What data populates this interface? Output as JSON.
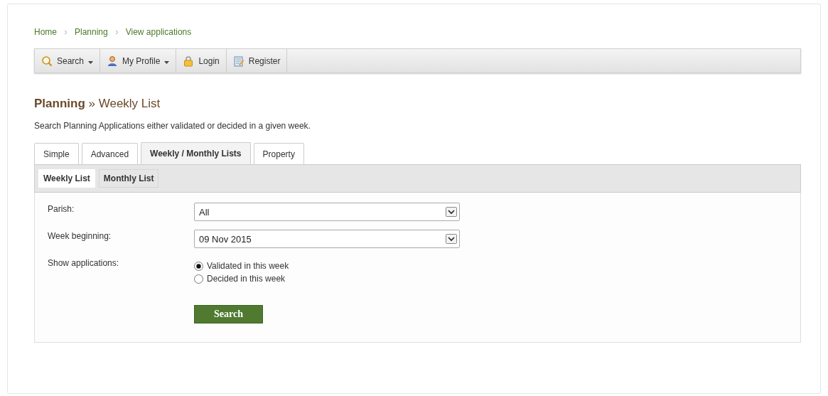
{
  "breadcrumb": [
    {
      "label": "Home"
    },
    {
      "label": "Planning"
    },
    {
      "label": "View applications"
    }
  ],
  "toolbar": [
    {
      "label": "Search",
      "dropdown": true
    },
    {
      "label": "My Profile",
      "dropdown": true
    },
    {
      "label": "Login",
      "dropdown": false
    },
    {
      "label": "Register",
      "dropdown": false
    }
  ],
  "heading": {
    "section": "Planning",
    "separator": "»",
    "page": "Weekly List"
  },
  "description": "Search Planning Applications either validated or decided in a given week.",
  "tabs": [
    {
      "label": "Simple",
      "selected": false
    },
    {
      "label": "Advanced",
      "selected": false
    },
    {
      "label": "Weekly / Monthly Lists",
      "selected": true
    },
    {
      "label": "Property",
      "selected": false
    }
  ],
  "subtabs": [
    {
      "label": "Weekly List",
      "selected": true
    },
    {
      "label": "Monthly List",
      "selected": false
    }
  ],
  "form": {
    "parish": {
      "label": "Parish:",
      "value": "All"
    },
    "week": {
      "label": "Week beginning:",
      "value": "09 Nov 2015"
    },
    "show": {
      "label": "Show applications:",
      "options": [
        {
          "label": "Validated in this week",
          "selected": true
        },
        {
          "label": "Decided in this week",
          "selected": false
        }
      ]
    },
    "button": "Search"
  }
}
